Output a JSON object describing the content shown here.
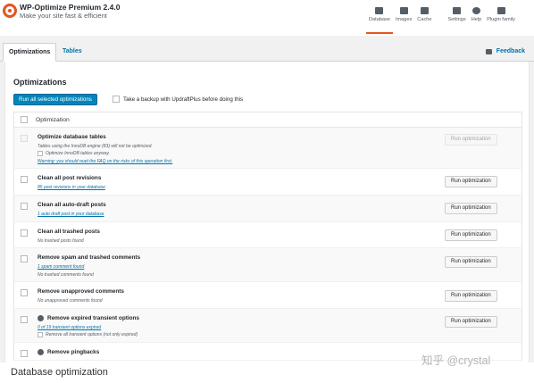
{
  "app": {
    "title": "WP-Optimize Premium 2.4.0",
    "subtitle": "Make your site fast & efficient"
  },
  "topnav": {
    "items": [
      {
        "label": "Database",
        "icon": "database-icon"
      },
      {
        "label": "Images",
        "icon": "images-icon"
      },
      {
        "label": "Cache",
        "icon": "cache-icon"
      },
      {
        "label": "Settings",
        "icon": "settings-icon"
      },
      {
        "label": "Help",
        "icon": "help-icon"
      },
      {
        "label": "Plugin family",
        "icon": "plugin-family-icon"
      }
    ],
    "active": "Database"
  },
  "tabs": {
    "items": [
      {
        "label": "Optimizations"
      },
      {
        "label": "Tables"
      }
    ],
    "feedback": "Feedback"
  },
  "main": {
    "title": "Optimizations",
    "run_all_button": "Run all selected optimizations",
    "backup_label": "Take a backup with UpdraftPlus before doing this",
    "column_header": "Optimization",
    "rows": [
      {
        "name": "Optimize database tables",
        "line1": "Tables using the InnoDB engine (83) will not be optimized.",
        "line2": "Optimize InnoDB tables anyway.",
        "line3": "Warning: you should read the FAQ on the risks of this operation first.",
        "button": "Run optimization"
      },
      {
        "name": "Clean all post revisions",
        "line1": "85 post revisions in your database",
        "button": "Run optimization"
      },
      {
        "name": "Clean all auto-draft posts",
        "line1": "1 auto draft post in your database",
        "button": "Run optimization"
      },
      {
        "name": "Clean all trashed posts",
        "line1": "No trashed posts found",
        "button": "Run optimization"
      },
      {
        "name": "Remove spam and trashed comments",
        "line1": "1 spam comment found",
        "line2": "No trashed comments found",
        "button": "Run optimization"
      },
      {
        "name": "Remove unapproved comments",
        "line1": "No unapproved comments found",
        "button": "Run optimization"
      },
      {
        "name": "Remove expired transient options",
        "line1": "0 of 19 transient options expired",
        "line2": "Remove all transient options (not only expired)",
        "button": "Run optimization"
      },
      {
        "name": "Remove pingbacks"
      }
    ]
  },
  "caption": "Database optimization",
  "watermark": "知乎 @crystal",
  "colors": {
    "accent": "#e2571e",
    "primary_button": "#0085ba",
    "link": "#0073aa"
  }
}
